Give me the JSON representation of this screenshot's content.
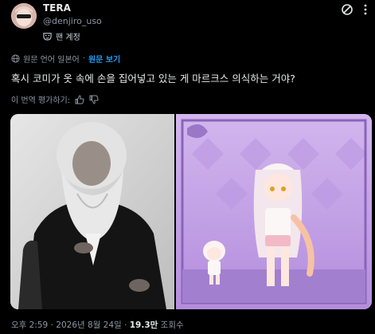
{
  "author": {
    "display_name": "TERA",
    "handle": "@denjiro_uso",
    "badge_label": "팬 계정"
  },
  "translation": {
    "notice": "원문 언어 일본어",
    "show_original": "원문 보기",
    "rate_prompt": "이 번역 평가하기:"
  },
  "tweet": {
    "text": "혹시 코미가 옷 속에 손을 집어넣고 있는 게 마르크스 의식하는 거야?"
  },
  "meta": {
    "time": "오후 2:59",
    "dot1": "·",
    "date": "2026년 8월 24일",
    "dot2": "·",
    "views_count": "19.3만",
    "views_label": "조회수"
  },
  "colors": {
    "background": "#000000",
    "accent": "#1d9bf0",
    "text_primary": "#e7e9ea",
    "text_secondary": "#8b98a5",
    "right_image_bg": "#c8a8e8"
  },
  "icons": {
    "header_action": "slash-circle-icon",
    "more": "more-vertical-icon",
    "badge": "fan-mask-icon",
    "translation": "globe-icon",
    "thumbs_up": "thumbs-up-icon",
    "thumbs_down": "thumbs-down-icon"
  }
}
